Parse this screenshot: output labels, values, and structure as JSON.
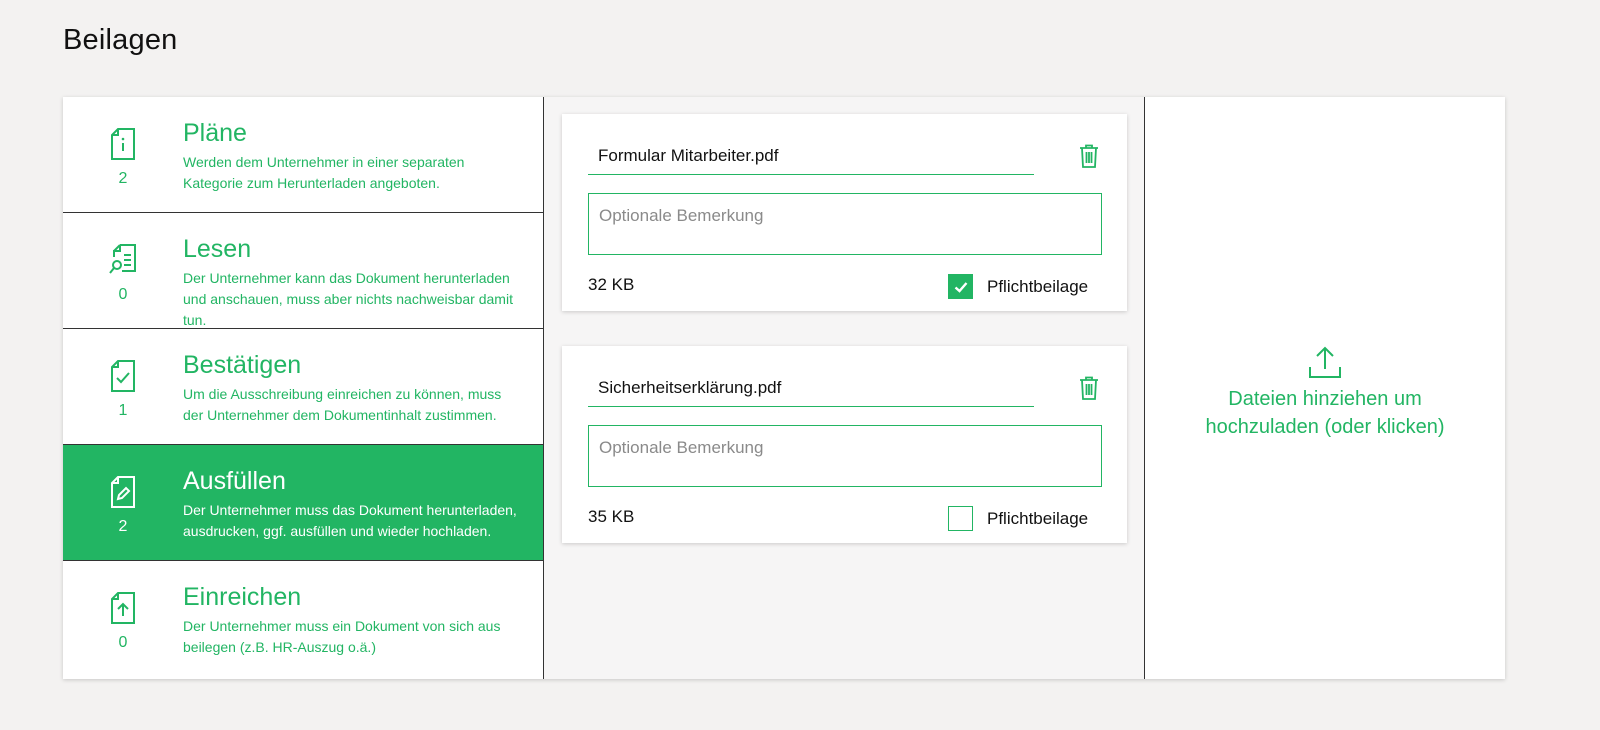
{
  "page": {
    "title": "Beilagen"
  },
  "categories": [
    {
      "icon": "document-info-icon",
      "title": "Pläne",
      "count": "2",
      "description": "Werden dem Unternehmer in einer separaten Kategorie zum Herunterladen angeboten."
    },
    {
      "icon": "document-search-icon",
      "title": "Lesen",
      "count": "0",
      "description": "Der Unternehmer kann das Dokument herunterladen und anschauen, muss aber nichts nachweisbar damit tun."
    },
    {
      "icon": "document-check-icon",
      "title": "Bestätigen",
      "count": "1",
      "description": "Um die Ausschreibung einreichen zu können, muss der Unternehmer dem Dokumentinhalt zustimmen."
    },
    {
      "icon": "document-edit-icon",
      "title": "Ausfüllen",
      "count": "2",
      "description": "Der Unternehmer muss das Dokument herunterladen, ausdrucken, ggf. ausfüllen und wieder hochladen."
    },
    {
      "icon": "document-upload-icon",
      "title": "Einreichen",
      "count": "0",
      "description": "Der Unternehmer muss ein Dokument von sich aus beilegen (z.B. HR-Auszug o.ä.)"
    }
  ],
  "active_category": "Ausfüllen",
  "files": [
    {
      "name": "Formular Mitarbeiter.pdf",
      "remark_placeholder": "Optionale Bemerkung",
      "remark_value": "",
      "size": "32 KB",
      "mandatory_label": "Pflichtbeilage",
      "mandatory": true
    },
    {
      "name": "Sicherheitserklärung.pdf",
      "remark_placeholder": "Optionale Bemerkung",
      "remark_value": "",
      "size": "35 KB",
      "mandatory_label": "Pflichtbeilage",
      "mandatory": false
    }
  ],
  "dropzone": {
    "icon": "upload-icon",
    "line1": "Dateien hinziehen um",
    "line2": "hochzuladen (oder klicken)"
  },
  "colors": {
    "accent": "#22b563",
    "background": "#f3f2f1",
    "panel": "#ffffff",
    "divider": "#333333"
  }
}
